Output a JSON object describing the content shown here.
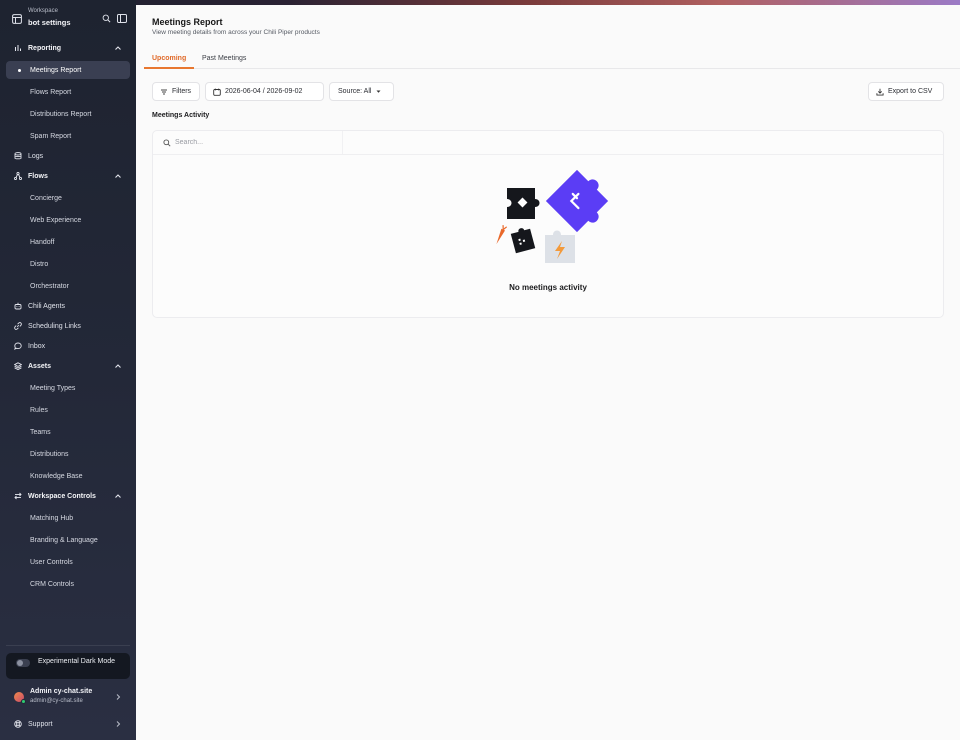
{
  "workspace": {
    "label": "Workspace",
    "name": "bot settings"
  },
  "sidebar": {
    "reporting": {
      "label": "Reporting",
      "items": [
        "Meetings Report",
        "Flows Report",
        "Distributions Report",
        "Spam Report"
      ]
    },
    "logs": "Logs",
    "flows": {
      "label": "Flows",
      "items": [
        "Concierge",
        "Web Experience",
        "Handoff",
        "Distro",
        "Orchestrator"
      ]
    },
    "chili_agents": "Chili Agents",
    "scheduling_links": "Scheduling Links",
    "inbox": "Inbox",
    "assets": {
      "label": "Assets",
      "items": [
        "Meeting Types",
        "Rules",
        "Teams",
        "Distributions",
        "Knowledge Base"
      ]
    },
    "workspace_controls": {
      "label": "Workspace Controls",
      "items": [
        "Matching Hub",
        "Branding & Language",
        "User Controls",
        "CRM Controls"
      ]
    },
    "dark_mode_label": "Experimental Dark Mode",
    "user": {
      "name": "Admin cy-chat.site",
      "email": "admin@cy-chat.site"
    },
    "support": "Support"
  },
  "header": {
    "title": "Meetings Report",
    "subtitle": "View meeting details from across your Chili Piper products"
  },
  "tabs": [
    {
      "label": "Upcoming",
      "active": true
    },
    {
      "label": "Past Meetings",
      "active": false
    }
  ],
  "toolbar": {
    "filters_label": "Filters",
    "date_range": "2026-06-04 / 2026-09-02",
    "source_label": "Source: All",
    "export_label": "Export to CSV"
  },
  "activity": {
    "title": "Meetings Activity",
    "search_placeholder": "Search...",
    "empty_text": "No meetings activity"
  },
  "colors": {
    "accent": "#e8772f",
    "purple": "#5b3df5",
    "sidebar_bg": "#1e2330"
  }
}
